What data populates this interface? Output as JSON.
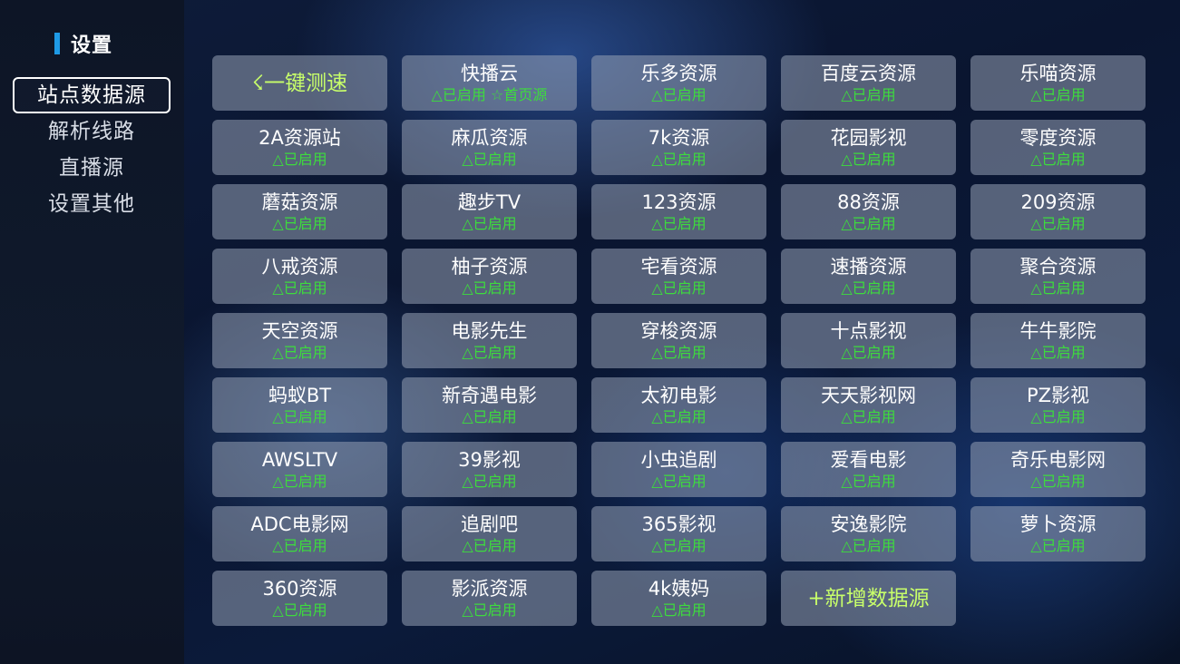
{
  "sidebar": {
    "title": "设置",
    "items": [
      {
        "label": "站点数据源",
        "active": true
      },
      {
        "label": "解析线路",
        "active": false
      },
      {
        "label": "直播源",
        "active": false
      },
      {
        "label": "设置其他",
        "active": false
      }
    ]
  },
  "colors": {
    "accent": "#1e9ae6",
    "status_green": "#3ddc3d",
    "action_yellow_green": "#c8ff6a",
    "tile_bg": "#969fb4"
  },
  "grid": {
    "speed_test_label": "☇一键测速",
    "add_source_label": "+新增数据源",
    "sources": [
      {
        "name": "快播云",
        "status": "△已启用 ☆首页源"
      },
      {
        "name": "乐多资源",
        "status": "△已启用"
      },
      {
        "name": "百度云资源",
        "status": "△已启用"
      },
      {
        "name": "乐喵资源",
        "status": "△已启用"
      },
      {
        "name": "2A资源站",
        "status": "△已启用"
      },
      {
        "name": "麻瓜资源",
        "status": "△已启用"
      },
      {
        "name": "7k资源",
        "status": "△已启用"
      },
      {
        "name": "花园影视",
        "status": "△已启用"
      },
      {
        "name": "零度资源",
        "status": "△已启用"
      },
      {
        "name": "蘑菇资源",
        "status": "△已启用"
      },
      {
        "name": "趣步TV",
        "status": "△已启用"
      },
      {
        "name": "123资源",
        "status": "△已启用"
      },
      {
        "name": "88资源",
        "status": "△已启用"
      },
      {
        "name": "209资源",
        "status": "△已启用"
      },
      {
        "name": "八戒资源",
        "status": "△已启用"
      },
      {
        "name": "柚子资源",
        "status": "△已启用"
      },
      {
        "name": "宅看资源",
        "status": "△已启用"
      },
      {
        "name": "速播资源",
        "status": "△已启用"
      },
      {
        "name": "聚合资源",
        "status": "△已启用"
      },
      {
        "name": "天空资源",
        "status": "△已启用"
      },
      {
        "name": "电影先生",
        "status": "△已启用"
      },
      {
        "name": "穿梭资源",
        "status": "△已启用"
      },
      {
        "name": "十点影视",
        "status": "△已启用"
      },
      {
        "name": "牛牛影院",
        "status": "△已启用"
      },
      {
        "name": "蚂蚁BT",
        "status": "△已启用"
      },
      {
        "name": "新奇遇电影",
        "status": "△已启用"
      },
      {
        "name": "太初电影",
        "status": "△已启用"
      },
      {
        "name": "天天影视网",
        "status": "△已启用"
      },
      {
        "name": "PZ影视",
        "status": "△已启用"
      },
      {
        "name": "AWSLTV",
        "status": "△已启用"
      },
      {
        "name": "39影视",
        "status": "△已启用"
      },
      {
        "name": "小虫追剧",
        "status": "△已启用"
      },
      {
        "name": "爱看电影",
        "status": "△已启用"
      },
      {
        "name": "奇乐电影网",
        "status": "△已启用"
      },
      {
        "name": "ADC电影网",
        "status": "△已启用"
      },
      {
        "name": "追剧吧",
        "status": "△已启用"
      },
      {
        "name": "365影视",
        "status": "△已启用"
      },
      {
        "name": "安逸影院",
        "status": "△已启用"
      },
      {
        "name": "萝卜资源",
        "status": "△已启用"
      },
      {
        "name": "360资源",
        "status": "△已启用"
      },
      {
        "name": "影派资源",
        "status": "△已启用"
      },
      {
        "name": "4k姨妈",
        "status": "△已启用"
      }
    ]
  }
}
